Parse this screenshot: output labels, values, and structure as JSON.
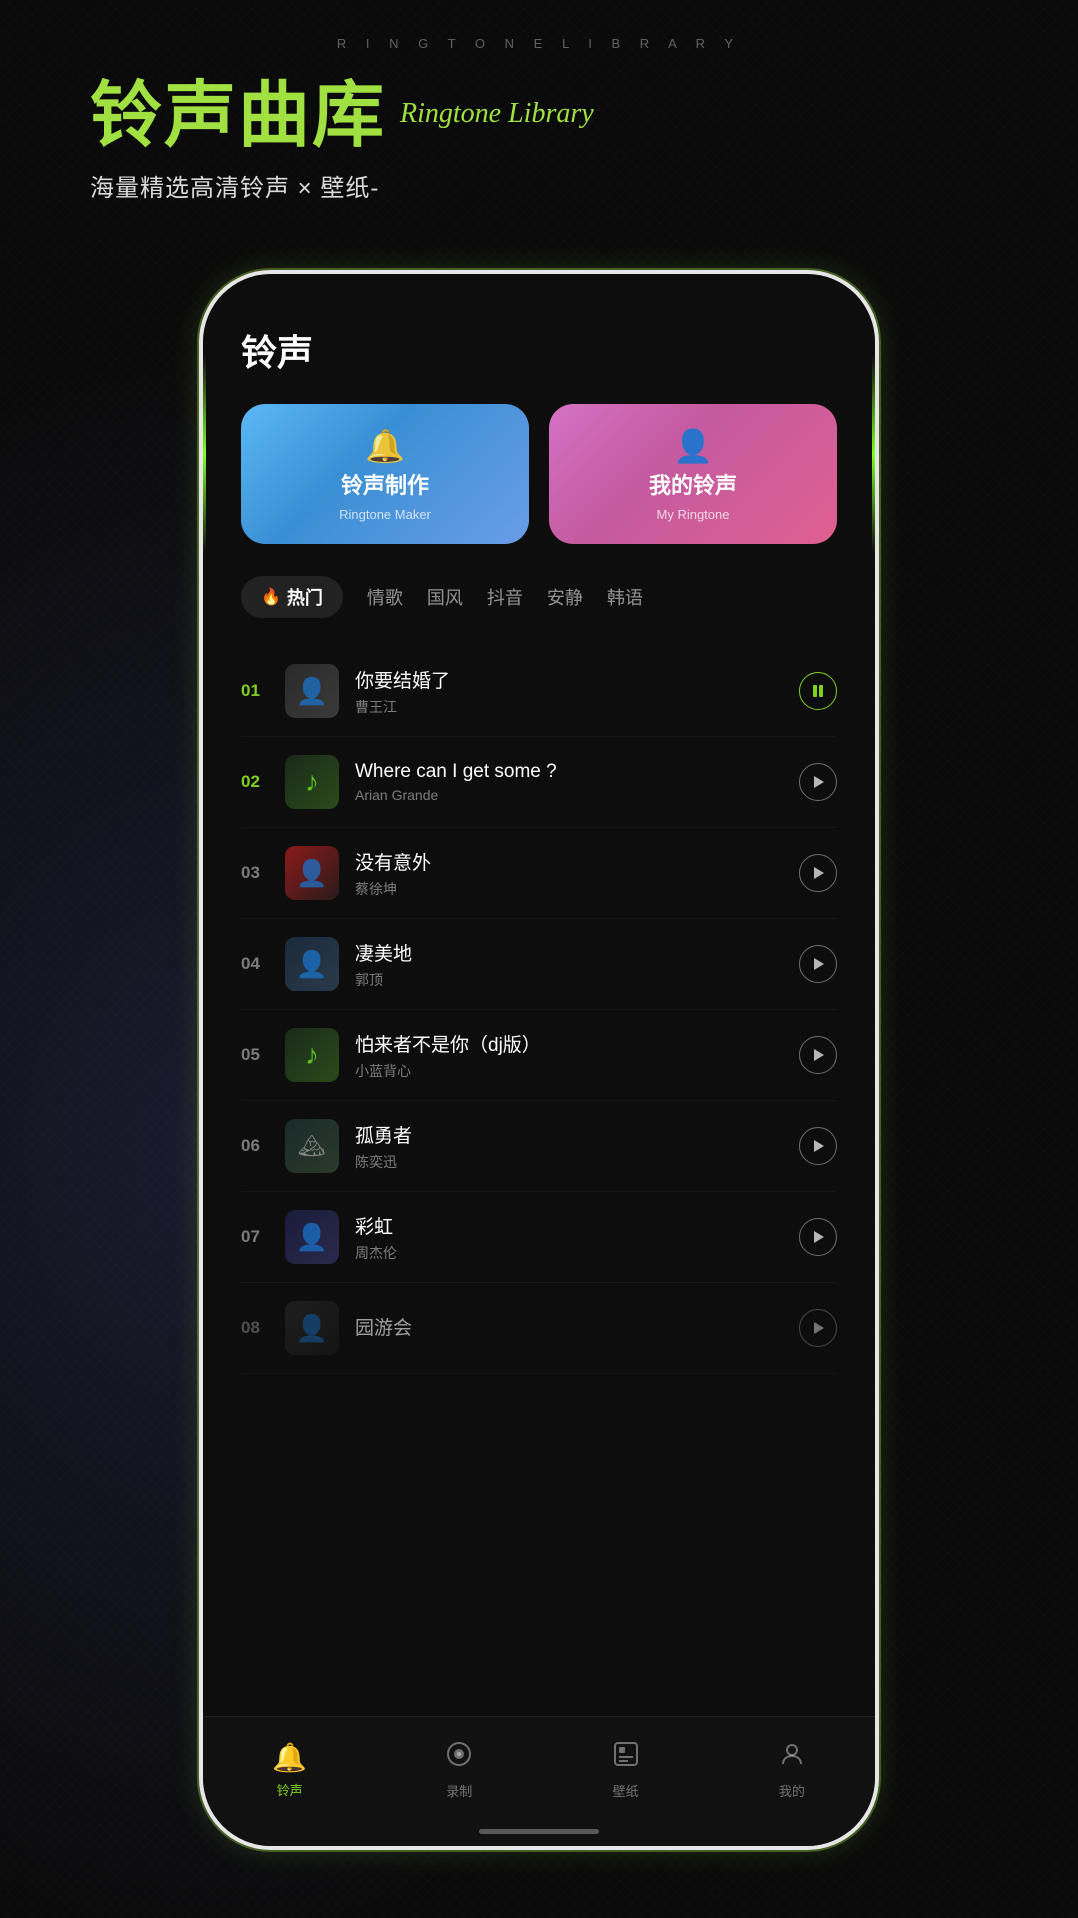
{
  "topbar": {
    "text": "R I N G T O N E   L I B R A R Y"
  },
  "header": {
    "title_cn": "铃声曲库",
    "title_en": "Ringtone Library",
    "subtitle": "海量精选高清铃声 × 壁纸-"
  },
  "cards": [
    {
      "id": "maker",
      "title_cn": "铃声制作",
      "title_en": "Ringtone Maker",
      "icon": "🔔"
    },
    {
      "id": "my",
      "title_cn": "我的铃声",
      "title_en": "My Ringtone",
      "icon": "👤"
    }
  ],
  "tabs": [
    {
      "id": "hot",
      "label": "热门",
      "active": true,
      "fire": true
    },
    {
      "id": "love",
      "label": "情歌",
      "active": false
    },
    {
      "id": "cn",
      "label": "国风",
      "active": false
    },
    {
      "id": "douyin",
      "label": "抖音",
      "active": false
    },
    {
      "id": "quiet",
      "label": "安静",
      "active": false
    },
    {
      "id": "korean",
      "label": "韩语",
      "active": false
    }
  ],
  "songs": [
    {
      "num": "01",
      "title": "你要结婚了",
      "artist": "曹王江",
      "highlighted": true,
      "playing": true,
      "thumbClass": "thumb-1",
      "thumbContent": "person"
    },
    {
      "num": "02",
      "title": "Where can I get some ?",
      "artist": "Arian Grande",
      "highlighted": true,
      "playing": false,
      "thumbClass": "thumb-2",
      "thumbContent": "green"
    },
    {
      "num": "03",
      "title": "没有意外",
      "artist": "蔡徐坤",
      "highlighted": false,
      "playing": false,
      "thumbClass": "thumb-3",
      "thumbContent": "person"
    },
    {
      "num": "04",
      "title": "凄美地",
      "artist": "郭顶",
      "highlighted": false,
      "playing": false,
      "thumbClass": "thumb-4",
      "thumbContent": "person"
    },
    {
      "num": "05",
      "title": "怕来者不是你（dj版）",
      "artist": "小蓝背心",
      "highlighted": false,
      "playing": false,
      "thumbClass": "thumb-5",
      "thumbContent": "green"
    },
    {
      "num": "06",
      "title": "孤勇者",
      "artist": "陈奕迅",
      "highlighted": false,
      "playing": false,
      "thumbClass": "thumb-6",
      "thumbContent": "landscape"
    },
    {
      "num": "07",
      "title": "彩虹",
      "artist": "周杰伦",
      "highlighted": false,
      "playing": false,
      "thumbClass": "thumb-7",
      "thumbContent": "person"
    },
    {
      "num": "08",
      "title": "园游会",
      "artist": "",
      "highlighted": false,
      "playing": false,
      "thumbClass": "thumb-8",
      "thumbContent": "person",
      "partial": true
    }
  ],
  "nav": [
    {
      "id": "ringtone",
      "label": "铃声",
      "icon": "🔔",
      "active": true
    },
    {
      "id": "record",
      "label": "录制",
      "icon": "⬡",
      "active": false
    },
    {
      "id": "wallpaper",
      "label": "壁纸",
      "icon": "◫",
      "active": false
    },
    {
      "id": "mine",
      "label": "我的",
      "icon": "◑",
      "active": false
    }
  ],
  "page_title": "铃声"
}
